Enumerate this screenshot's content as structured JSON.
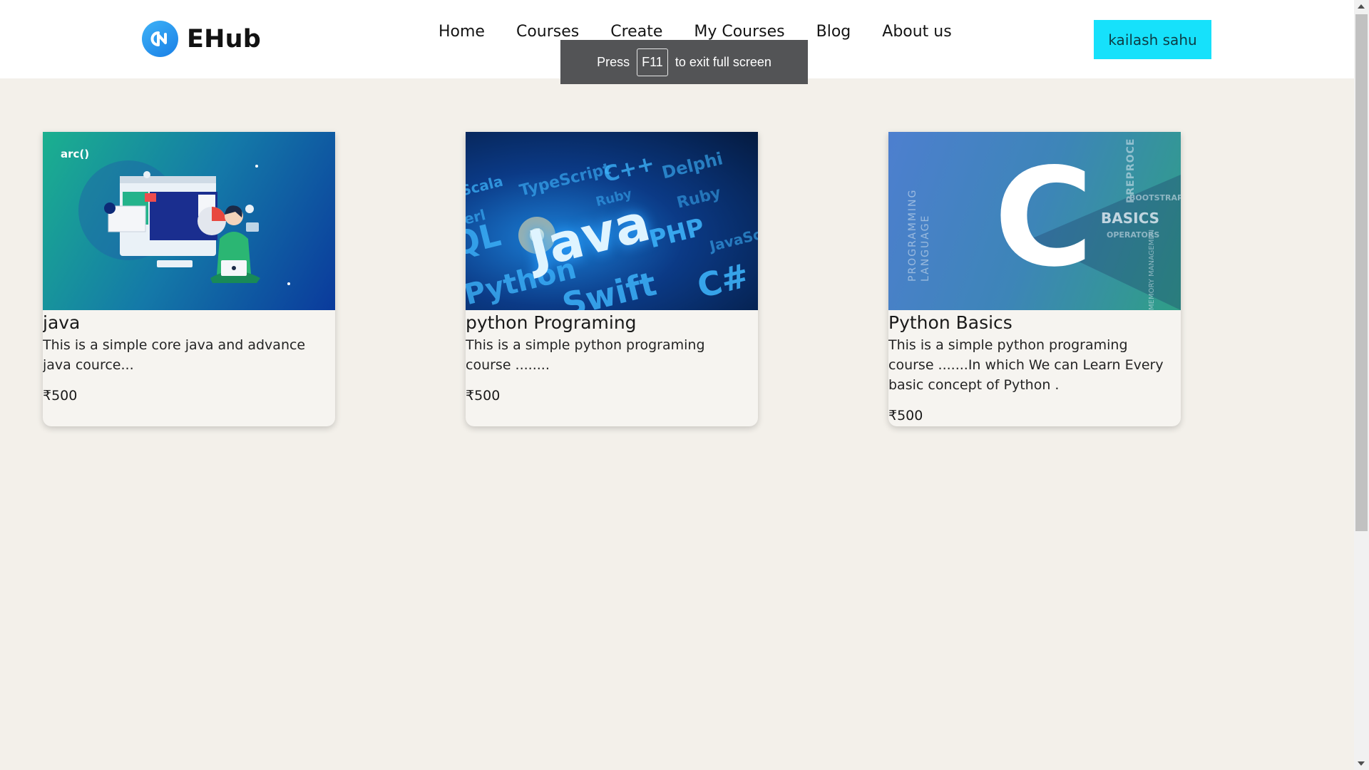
{
  "brand": {
    "name": "EHub"
  },
  "nav": {
    "items": [
      "Home",
      "Courses",
      "Create",
      "My Courses",
      "Blog",
      "About us"
    ]
  },
  "user": {
    "name": "kailash sahu"
  },
  "fullscreen_toast": {
    "prefix": "Press",
    "key": "F11",
    "suffix": "to exit full screen"
  },
  "courses": [
    {
      "title": "java",
      "description": "This is a simple core java and advance java cource...",
      "price": "₹500",
      "image_icon": "java-course-illustration",
      "image_text": "arc()"
    },
    {
      "title": "python Programing",
      "description": "This is a simple python programing course ........",
      "price": "₹500",
      "image_icon": "programming-languages-image",
      "image_text": "Java"
    },
    {
      "title": "Python Basics",
      "description": "This is a simple python programing course .......In which We can Learn Every basic concept of Python .",
      "price": "₹500",
      "image_icon": "c-language-image",
      "image_text": "C"
    }
  ]
}
